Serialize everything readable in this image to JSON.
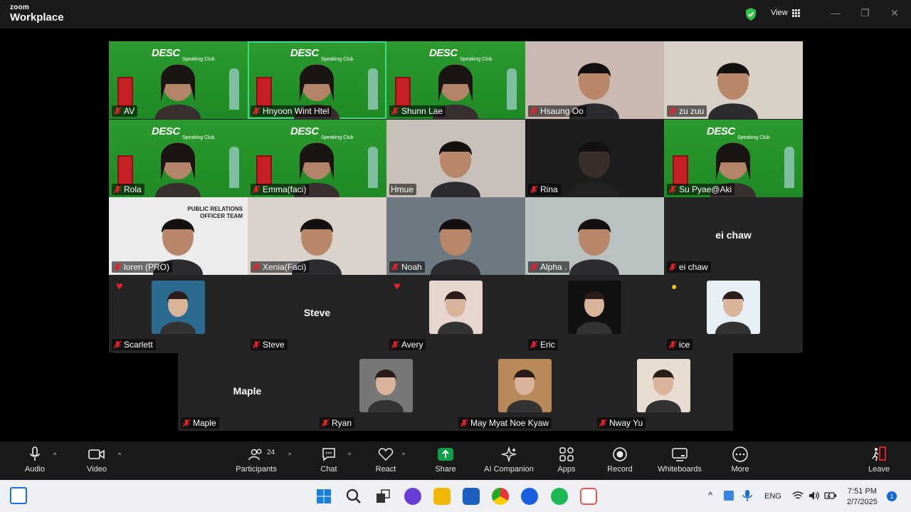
{
  "app": {
    "brand_top": "zoom",
    "brand_bottom": "Workplace",
    "view_label": "View"
  },
  "participants": [
    {
      "name": "AV",
      "style": "green",
      "has_banner": true
    },
    {
      "name": "Hnyoon Wint Htel",
      "style": "green",
      "has_banner": true,
      "active": true
    },
    {
      "name": "Shunn Lae",
      "style": "green",
      "has_banner": true
    },
    {
      "name": "Hsaung Oo",
      "style": "photo",
      "bg": "#c9b9b0"
    },
    {
      "name": "zu zuu",
      "style": "photo",
      "bg": "#d8cfc6"
    },
    {
      "name": "Rola",
      "style": "green",
      "has_banner": true
    },
    {
      "name": "Emma(faci)",
      "style": "green",
      "has_banner": true
    },
    {
      "name": "Hmue",
      "style": "photo",
      "bg": "#c8c0b8",
      "mic_on": true
    },
    {
      "name": "Rina",
      "style": "photo",
      "bg": "#1d1d1d"
    },
    {
      "name": "Su Pyae@Aki",
      "style": "green",
      "has_banner": true
    },
    {
      "name": "loren (PRO)",
      "style": "photo",
      "bg": "#ececec"
    },
    {
      "name": "Xenia(Faci)",
      "style": "photo",
      "bg": "#d9d3cc"
    },
    {
      "name": "Noah",
      "style": "photo",
      "bg": "#6e7a83"
    },
    {
      "name": "Alpha .",
      "style": "photo",
      "bg": "#b9c2c0"
    },
    {
      "name": "ei chaw",
      "style": "name_only"
    },
    {
      "name": "Scarlett",
      "style": "avatar",
      "avatar_bg": "#2a6b8f",
      "reaction": "heart"
    },
    {
      "name": "Steve",
      "style": "name_only"
    },
    {
      "name": "Avery",
      "style": "avatar",
      "avatar_bg": "#e7d6d0",
      "reaction": "heart"
    },
    {
      "name": "Eric",
      "style": "avatar",
      "avatar_bg": "#111111"
    },
    {
      "name": "ice",
      "style": "avatar",
      "avatar_bg": "#e6eef6",
      "reaction": "egg"
    },
    {
      "name": "Maple",
      "style": "name_only"
    },
    {
      "name": "Ryan",
      "style": "avatar",
      "avatar_bg": "#777777"
    },
    {
      "name": "May Myat Noe Kyaw",
      "style": "avatar",
      "avatar_bg": "#b88a5a"
    },
    {
      "name": "Nway Yu",
      "style": "avatar",
      "avatar_bg": "#e8dcd0"
    }
  ],
  "banner": {
    "title": "DESC",
    "subtitle": "Speaking Club"
  },
  "pro_banner": {
    "line1": "PUBLIC RELATIONS",
    "line2": "OFFICER TEAM"
  },
  "toolbar": {
    "audio": "Audio",
    "video": "Video",
    "participants": "Participants",
    "participants_count": "24",
    "chat": "Chat",
    "react": "React",
    "share": "Share",
    "ai_companion": "AI Companion",
    "apps": "Apps",
    "record": "Record",
    "whiteboards": "Whiteboards",
    "more": "More",
    "leave": "Leave"
  },
  "taskbar": {
    "language": "ENG",
    "time": "7:51 PM",
    "date": "2/7/2025",
    "notifications": "1"
  },
  "colors": {
    "accent_green": "#3ddc84",
    "share_green": "#0e9f49",
    "mic_red": "#e8202a",
    "leave_red": "#e8202a"
  }
}
